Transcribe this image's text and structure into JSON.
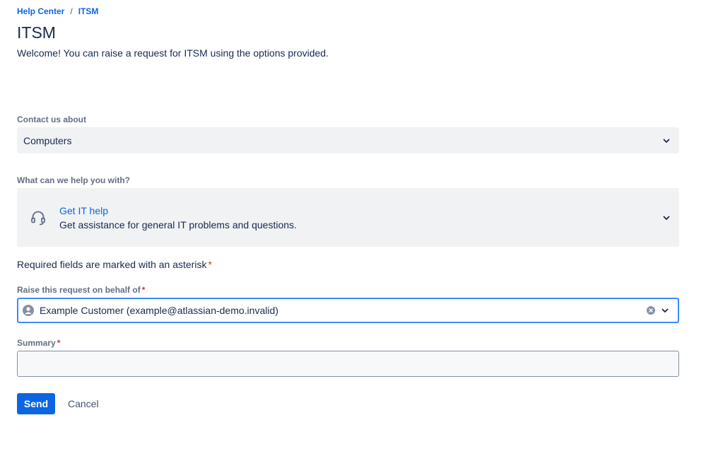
{
  "breadcrumb": {
    "items": [
      "Help Center",
      "ITSM"
    ],
    "separator": "/"
  },
  "page": {
    "title": "ITSM",
    "welcome": "Welcome! You can raise a request for ITSM using the options provided."
  },
  "contact": {
    "label": "Contact us about",
    "value": "Computers"
  },
  "help": {
    "label": "What can we help you with?",
    "service_title": "Get IT help",
    "service_description": "Get assistance for general IT problems and questions.",
    "icon": "headset-icon"
  },
  "required_note": {
    "text": "Required fields are marked with an asterisk",
    "asterisk": "*"
  },
  "behalf": {
    "label": "Raise this request on behalf of",
    "asterisk": "*",
    "value": "Example Customer (example@atlassian-demo.invalid)"
  },
  "summary": {
    "label": "Summary",
    "asterisk": "*",
    "value": ""
  },
  "actions": {
    "send_label": "Send",
    "cancel_label": "Cancel"
  },
  "colors": {
    "link": "#0c66e4",
    "primary": "#0c66e4",
    "focus_border": "#388bff",
    "required": "#c9372c",
    "field_bg": "#f1f2f4"
  }
}
